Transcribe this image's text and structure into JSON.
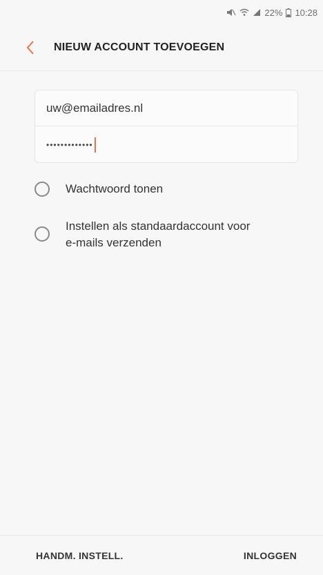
{
  "status_bar": {
    "battery": "22%",
    "time": "10:28",
    "icons": [
      "mute-icon",
      "wifi-icon",
      "signal-icon",
      "battery-icon"
    ]
  },
  "app_bar": {
    "title": "NIEUW ACCOUNT TOEVOEGEN",
    "back_icon": "chevron-left-icon",
    "accent_color": "#e8734a"
  },
  "form": {
    "email_value": "uw@emailadres.nl",
    "password_value": "•••••••••••••"
  },
  "options": {
    "show_password_label": "Wachtwoord tonen",
    "default_account_line1": "Instellen als standaardaccount voor",
    "default_account_line2": "e-mails verzenden"
  },
  "bottom_bar": {
    "manual_setup_label": "HANDM. INSTELL.",
    "login_label": "INLOGGEN"
  }
}
